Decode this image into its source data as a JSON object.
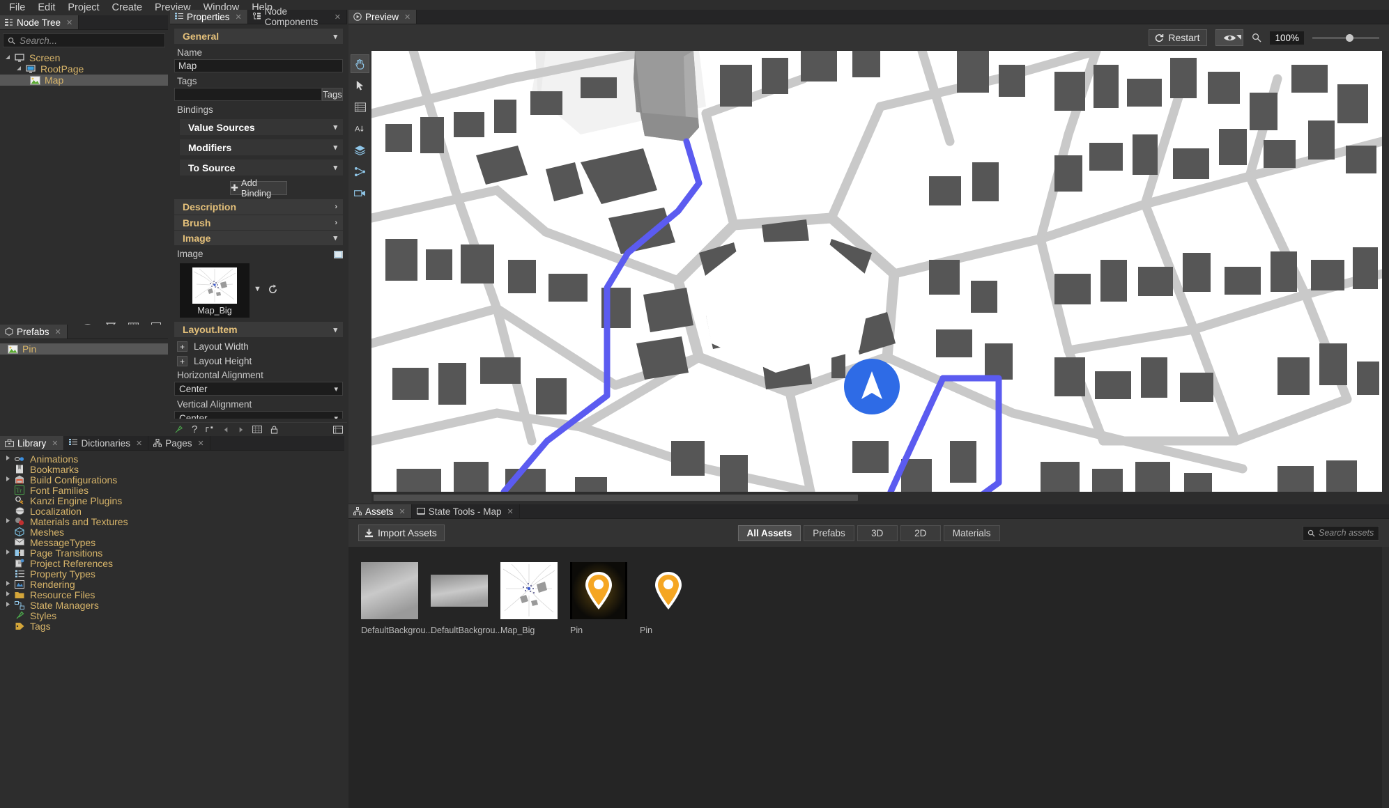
{
  "menu": {
    "items": [
      "File",
      "Edit",
      "Project",
      "Create",
      "Preview",
      "Window",
      "Help"
    ]
  },
  "node_tree": {
    "tab_label": "Node Tree",
    "search_placeholder": "Search...",
    "search_value": "",
    "nodes": [
      {
        "label": "Screen",
        "level": 1,
        "icon": "screen-icon",
        "selected": false,
        "expandable": true
      },
      {
        "label": "RootPage",
        "level": 2,
        "icon": "page-icon",
        "selected": false,
        "expandable": true
      },
      {
        "label": "Map",
        "level": 3,
        "icon": "image-node-icon",
        "selected": true,
        "expandable": false
      }
    ]
  },
  "prefabs": {
    "tab_label": "Prefabs",
    "items": [
      {
        "label": "Pin",
        "icon": "image-node-icon",
        "selected": true
      }
    ]
  },
  "library": {
    "tabs": [
      "Library",
      "Dictionaries",
      "Pages"
    ],
    "active_tab": "Library",
    "items": [
      {
        "label": "Animations",
        "expandable": true,
        "icon": "animation-icon"
      },
      {
        "label": "Bookmarks",
        "expandable": false,
        "icon": "bookmark-icon"
      },
      {
        "label": "Build Configurations",
        "expandable": true,
        "icon": "build-icon"
      },
      {
        "label": "Font Families",
        "expandable": false,
        "icon": "font-icon"
      },
      {
        "label": "Kanzi Engine Plugins",
        "expandable": false,
        "icon": "plugin-icon"
      },
      {
        "label": "Localization",
        "expandable": false,
        "icon": "localization-icon"
      },
      {
        "label": "Materials and Textures",
        "expandable": true,
        "icon": "material-icon"
      },
      {
        "label": "Meshes",
        "expandable": false,
        "icon": "mesh-icon"
      },
      {
        "label": "MessageTypes",
        "expandable": false,
        "icon": "message-icon"
      },
      {
        "label": "Page Transitions",
        "expandable": true,
        "icon": "transition-icon"
      },
      {
        "label": "Project References",
        "expandable": false,
        "icon": "reference-icon"
      },
      {
        "label": "Property Types",
        "expandable": false,
        "icon": "property-icon"
      },
      {
        "label": "Rendering",
        "expandable": true,
        "icon": "rendering-icon"
      },
      {
        "label": "Resource Files",
        "expandable": true,
        "icon": "resource-icon"
      },
      {
        "label": "State Managers",
        "expandable": true,
        "icon": "state-icon"
      },
      {
        "label": "Styles",
        "expandable": false,
        "icon": "style-icon"
      },
      {
        "label": "Tags",
        "expandable": false,
        "icon": "tag-icon"
      }
    ]
  },
  "properties": {
    "tabs": [
      "Properties",
      "Node Components"
    ],
    "active_tab": "Properties",
    "general_header": "General",
    "name_label": "Name",
    "name_value": "Map",
    "tags_label": "Tags",
    "tags_value": "",
    "tags_button": "Tags",
    "bindings_label": "Bindings",
    "binding_groups": [
      "Value Sources",
      "Modifiers",
      "To Source"
    ],
    "add_binding_label": "Add Binding",
    "sections": [
      "Description",
      "Brush",
      "Image"
    ],
    "image_label": "Image",
    "image_value": "Map_Big",
    "layout_header": "Layout.Item",
    "layout_width_label": "Layout Width",
    "layout_height_label": "Layout Height",
    "horizontal_alignment_label": "Horizontal Alignment",
    "horizontal_alignment_value": "Center",
    "vertical_alignment_label": "Vertical Alignment",
    "vertical_alignment_value": "Center"
  },
  "preview": {
    "tab_label": "Preview",
    "restart_label": "Restart",
    "zoom_value": "100%",
    "zoom_slider_percent": 50,
    "tools": [
      {
        "name": "pan-tool",
        "selected": true
      },
      {
        "name": "select-tool",
        "selected": false
      },
      {
        "name": "grid-tool",
        "selected": false
      },
      {
        "name": "text-tool",
        "selected": false
      },
      {
        "name": "layers-tool",
        "selected": false
      },
      {
        "name": "transition-tool",
        "selected": false
      },
      {
        "name": "camera-tool",
        "selected": false
      }
    ],
    "map": {
      "road_color": "#c4c4c4",
      "building_color": "#565656",
      "background_color": "#ffffff",
      "route_color": "#5b5bf0",
      "marker_color": "#2e6be6"
    }
  },
  "assets": {
    "tabs": [
      "Assets",
      "State Tools - Map"
    ],
    "active_tab": "Assets",
    "import_label": "Import Assets",
    "filters": [
      "All Assets",
      "Prefabs",
      "3D",
      "2D",
      "Materials"
    ],
    "active_filter": "All Assets",
    "search_placeholder": "Search assets...",
    "search_value": "",
    "items": [
      {
        "label": "DefaultBackgrou...",
        "type": "gradient-square"
      },
      {
        "label": "DefaultBackgrou...",
        "type": "gradient-wide"
      },
      {
        "label": "Map_Big",
        "type": "map-thumb"
      },
      {
        "label": "Pin",
        "type": "pin-dark"
      },
      {
        "label": "Pin",
        "type": "pin-plain"
      }
    ]
  }
}
